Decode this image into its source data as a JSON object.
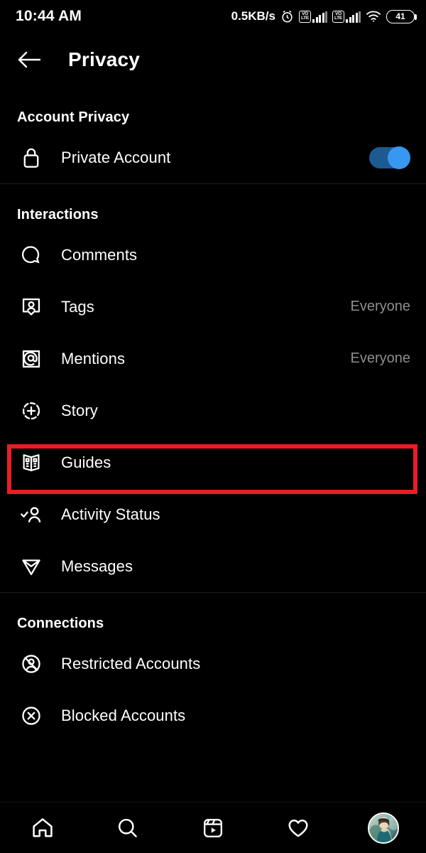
{
  "status_bar": {
    "time": "10:44 AM",
    "network_speed": "0.5KB/s",
    "alarm_icon": "alarm-clock-icon",
    "sim1_label_top": "VO",
    "sim1_label_bottom": "LTE",
    "sim2_label_top": "VO",
    "sim2_label_bottom": "LTE",
    "wifi_icon": "wifi-icon",
    "battery_level": "41"
  },
  "header": {
    "back_icon": "back-arrow-icon",
    "title": "Privacy"
  },
  "sections": [
    {
      "title": "Account Privacy",
      "rows": [
        {
          "icon": "lock-icon",
          "label": "Private Account",
          "value": "",
          "control": "toggle",
          "toggle_on": true
        }
      ]
    },
    {
      "title": "Interactions",
      "rows": [
        {
          "icon": "comment-bubble-icon",
          "label": "Comments",
          "value": ""
        },
        {
          "icon": "tag-person-icon",
          "label": "Tags",
          "value": "Everyone"
        },
        {
          "icon": "at-mention-icon",
          "label": "Mentions",
          "value": "Everyone"
        },
        {
          "icon": "story-plus-icon",
          "label": "Story",
          "value": "",
          "highlighted": true
        },
        {
          "icon": "guides-book-icon",
          "label": "Guides",
          "value": ""
        },
        {
          "icon": "activity-status-icon",
          "label": "Activity Status",
          "value": ""
        },
        {
          "icon": "messages-send-icon",
          "label": "Messages",
          "value": ""
        }
      ]
    },
    {
      "title": "Connections",
      "rows": [
        {
          "icon": "restricted-account-icon",
          "label": "Restricted Accounts",
          "value": ""
        },
        {
          "icon": "blocked-account-icon",
          "label": "Blocked Accounts",
          "value": ""
        }
      ]
    }
  ],
  "annotation": {
    "target": "Story",
    "color": "#e61e25"
  },
  "bottom_nav": [
    {
      "icon": "home-icon",
      "name": "nav-home"
    },
    {
      "icon": "search-icon",
      "name": "nav-search"
    },
    {
      "icon": "reels-icon",
      "name": "nav-reels"
    },
    {
      "icon": "heart-icon",
      "name": "nav-activity"
    },
    {
      "icon": "profile-avatar",
      "name": "nav-profile"
    }
  ],
  "colors": {
    "background": "#000000",
    "text_primary": "#ffffff",
    "text_secondary": "#8e8e8e",
    "toggle_on": "#3897f0",
    "toggle_track": "#1d5a91",
    "divider": "#1f1f1f",
    "annotation_red": "#e61e25"
  }
}
